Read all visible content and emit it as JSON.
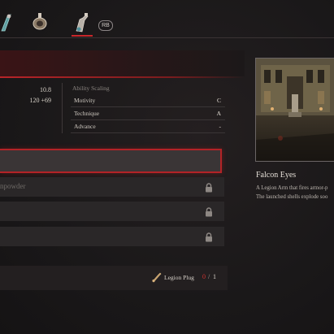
{
  "topbar": {
    "tabs": [
      {
        "name": "tab-item-1",
        "icon": "legion-arm-icon",
        "active": false
      },
      {
        "name": "tab-item-2",
        "icon": "amulet-icon",
        "active": false
      },
      {
        "name": "tab-item-3",
        "icon": "flask-arm-icon",
        "active": true
      }
    ],
    "rb_label": "RB"
  },
  "stats": {
    "value_1": "10.8",
    "value_2": "120 +69",
    "scaling_title": "Ability Scaling",
    "scaling": [
      {
        "label": "Motivity",
        "grade": "C"
      },
      {
        "label": "Technique",
        "grade": "A"
      },
      {
        "label": "Advance",
        "grade": "-"
      }
    ]
  },
  "slots": [
    {
      "label": "",
      "locked": false,
      "selected": true
    },
    {
      "label": "npowder",
      "locked": true,
      "selected": false
    },
    {
      "label": "",
      "locked": true,
      "selected": false
    },
    {
      "label": "",
      "locked": true,
      "selected": false
    }
  ],
  "requirement": {
    "icon": "legion-plug-icon",
    "name": "Legion Plug",
    "have": "0",
    "separator": "/",
    "need": "1"
  },
  "item": {
    "name": "Falcon Eyes",
    "desc_line_1": "A Legion Arm that fires armor-p",
    "desc_line_2": "The launched shells explode soo"
  },
  "colors": {
    "accent_red": "#b82428",
    "have_red": "#d3322f"
  }
}
